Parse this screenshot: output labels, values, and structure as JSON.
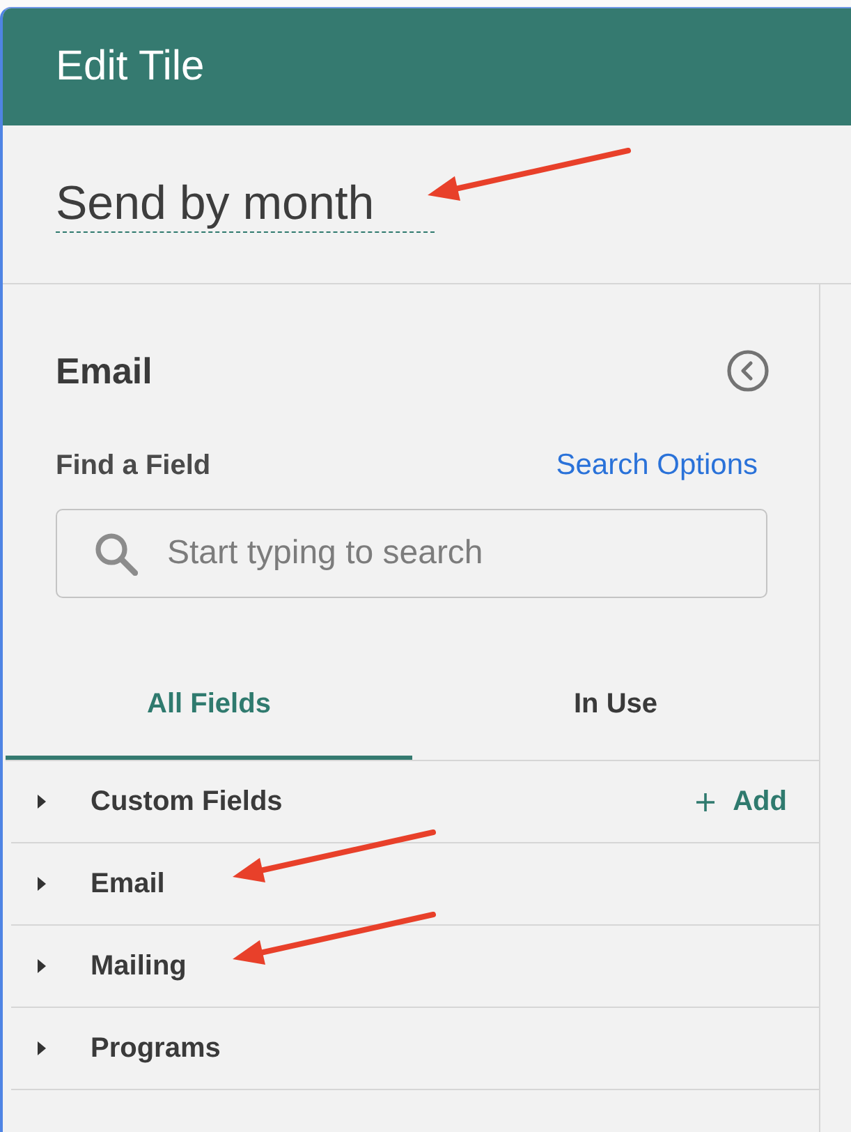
{
  "dialog": {
    "title": "Edit Tile"
  },
  "tile_name": {
    "value": "Send by month",
    "arrow_marked": true
  },
  "panel": {
    "title": "Email",
    "find_label": "Find a Field",
    "search_options_link": "Search Options",
    "search": {
      "placeholder": "Start typing to search"
    }
  },
  "tabs": [
    {
      "label": "All Fields",
      "selected": true
    },
    {
      "label": "In Use",
      "selected": false
    }
  ],
  "groups": [
    {
      "label": "Custom Fields",
      "expanded": false,
      "action": "Add",
      "arrow_marked": false
    },
    {
      "label": "Email",
      "expanded": false,
      "arrow_marked": true
    },
    {
      "label": "Mailing",
      "expanded": false,
      "arrow_marked": true
    },
    {
      "label": "Programs",
      "expanded": false,
      "arrow_marked": false
    }
  ]
}
